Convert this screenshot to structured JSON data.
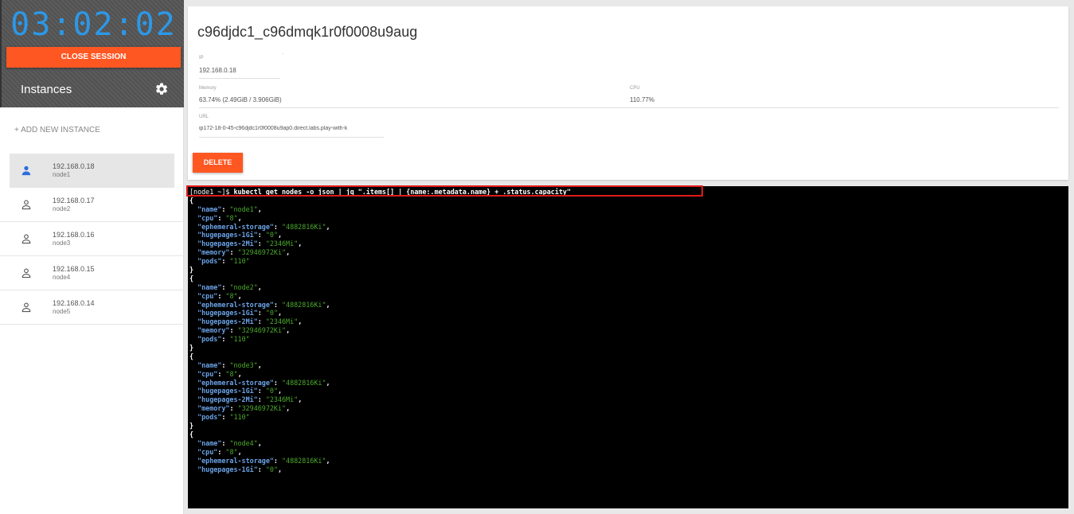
{
  "sidebar": {
    "timer": "03:02:02",
    "close_session_label": "CLOSE SESSION",
    "instances_title": "Instances",
    "add_instance_label": "+ ADD NEW INSTANCE",
    "instances": [
      {
        "ip": "192.168.0.18",
        "name": "node1",
        "active": true
      },
      {
        "ip": "192.168.0.17",
        "name": "node2",
        "active": false
      },
      {
        "ip": "192.168.0.16",
        "name": "node3",
        "active": false
      },
      {
        "ip": "192.168.0.15",
        "name": "node4",
        "active": false
      },
      {
        "ip": "192.168.0.14",
        "name": "node5",
        "active": false
      }
    ]
  },
  "instance": {
    "hostname": "c96djdc1_c96dmqk1r0f0008u9aug",
    "ip_label": "IP",
    "ip": "192.168.0.18",
    "memory_label": "Memory",
    "memory": "63.74% (2.49GiB / 3.906GiB)",
    "cpu_label": "CPU",
    "cpu": "110.77%",
    "url_label": "URL",
    "url": "ip172-18-0-45-c96djdc1r0f0008u9ap0.direct.labs.play-with-k",
    "delete_label": "DELETE"
  },
  "terminal": {
    "prompt": "[node1 ~]$ ",
    "command": "kubectl get nodes -o json | jq \".items[] | {name:.metadata.name} + .status.capacity\"",
    "highlight_color": "#e01a1a",
    "objects": [
      {
        "name": "node1",
        "cpu": "8",
        "ephemeral-storage": "4882816Ki",
        "hugepages-1Gi": "0",
        "hugepages-2Mi": "2346Mi",
        "memory": "32946972Ki",
        "pods": "110"
      },
      {
        "name": "node2",
        "cpu": "8",
        "ephemeral-storage": "4882816Ki",
        "hugepages-1Gi": "0",
        "hugepages-2Mi": "2346Mi",
        "memory": "32946972Ki",
        "pods": "110"
      },
      {
        "name": "node3",
        "cpu": "8",
        "ephemeral-storage": "4882816Ki",
        "hugepages-1Gi": "0",
        "hugepages-2Mi": "2346Mi",
        "memory": "32946972Ki",
        "pods": "110"
      },
      {
        "name": "node4",
        "cpu": "8",
        "ephemeral-storage": "4882816Ki",
        "hugepages-1Gi": "0"
      }
    ]
  },
  "colors": {
    "accent": "#ff5722",
    "timer": "#2c98e8",
    "json_key": "#6ba3e8",
    "json_string": "#4caa2c"
  }
}
